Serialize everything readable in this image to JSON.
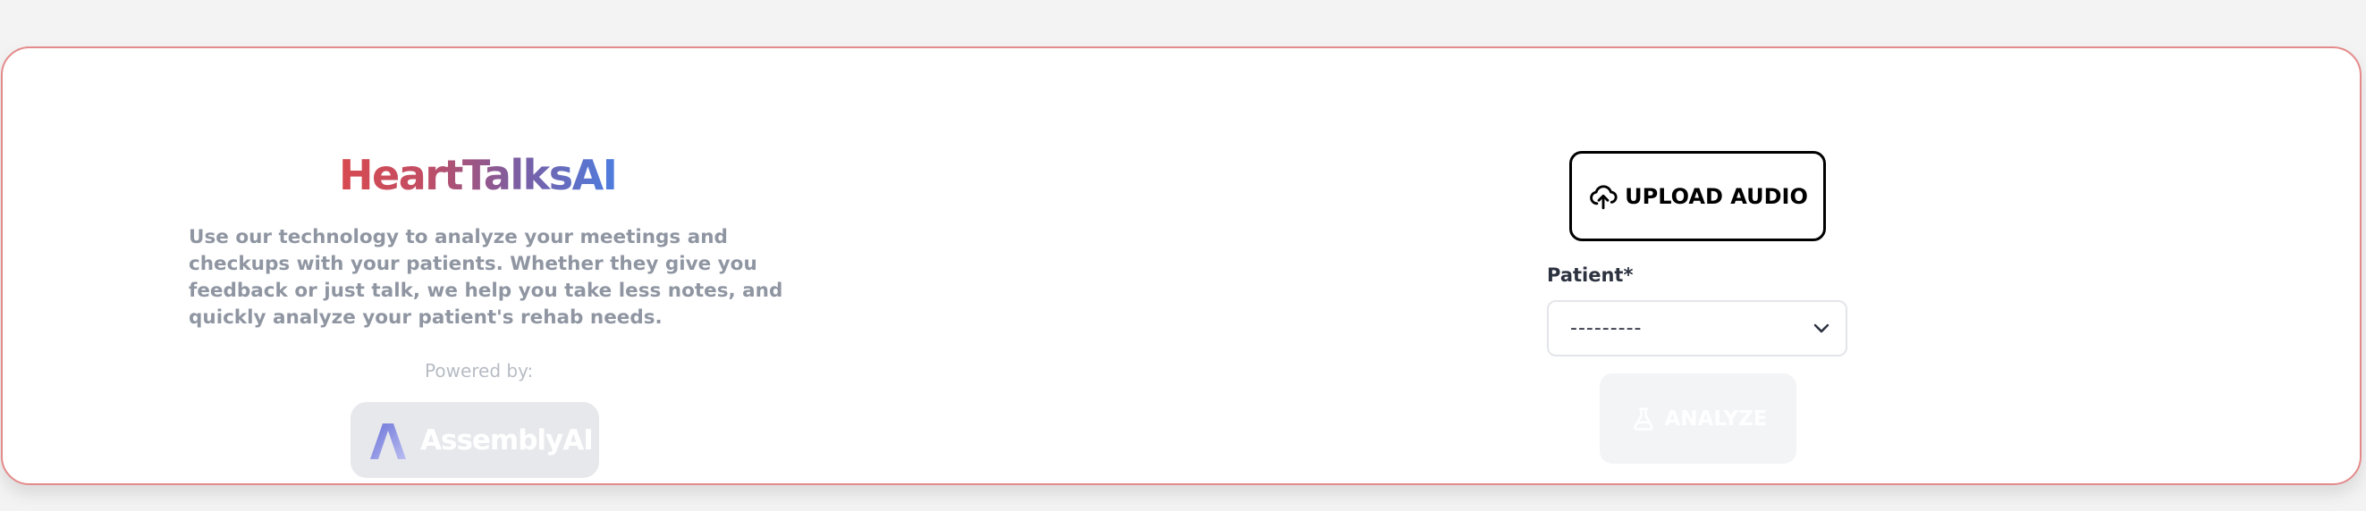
{
  "brand": {
    "title": "HeartTalksAI",
    "gradient_colors": [
      "#d84a4f",
      "#c24d63",
      "#7b5ea3",
      "#4d7ddf"
    ]
  },
  "intro": {
    "description": "Use our technology to analyze your meetings and checkups with your patients. Whether they give you feedback or just talk, we help you take less notes, and quickly analyze your patient's rehab needs."
  },
  "powered_by": {
    "label": "Powered by:",
    "partner_name": "AssemblyAI",
    "icon": "assemblyai-logo-icon"
  },
  "upload": {
    "label": "UPLOAD AUDIO",
    "icon": "cloud-upload-icon"
  },
  "patient": {
    "label": "Patient*",
    "selected_value": "---------",
    "icon": "chevron-down-icon"
  },
  "analyze": {
    "label": "ANALYZE",
    "icon": "flask-icon",
    "disabled": true
  },
  "colors": {
    "card_border": "#e58a8a",
    "text_muted": "#8f96a2",
    "text_dark": "#2d3240"
  }
}
